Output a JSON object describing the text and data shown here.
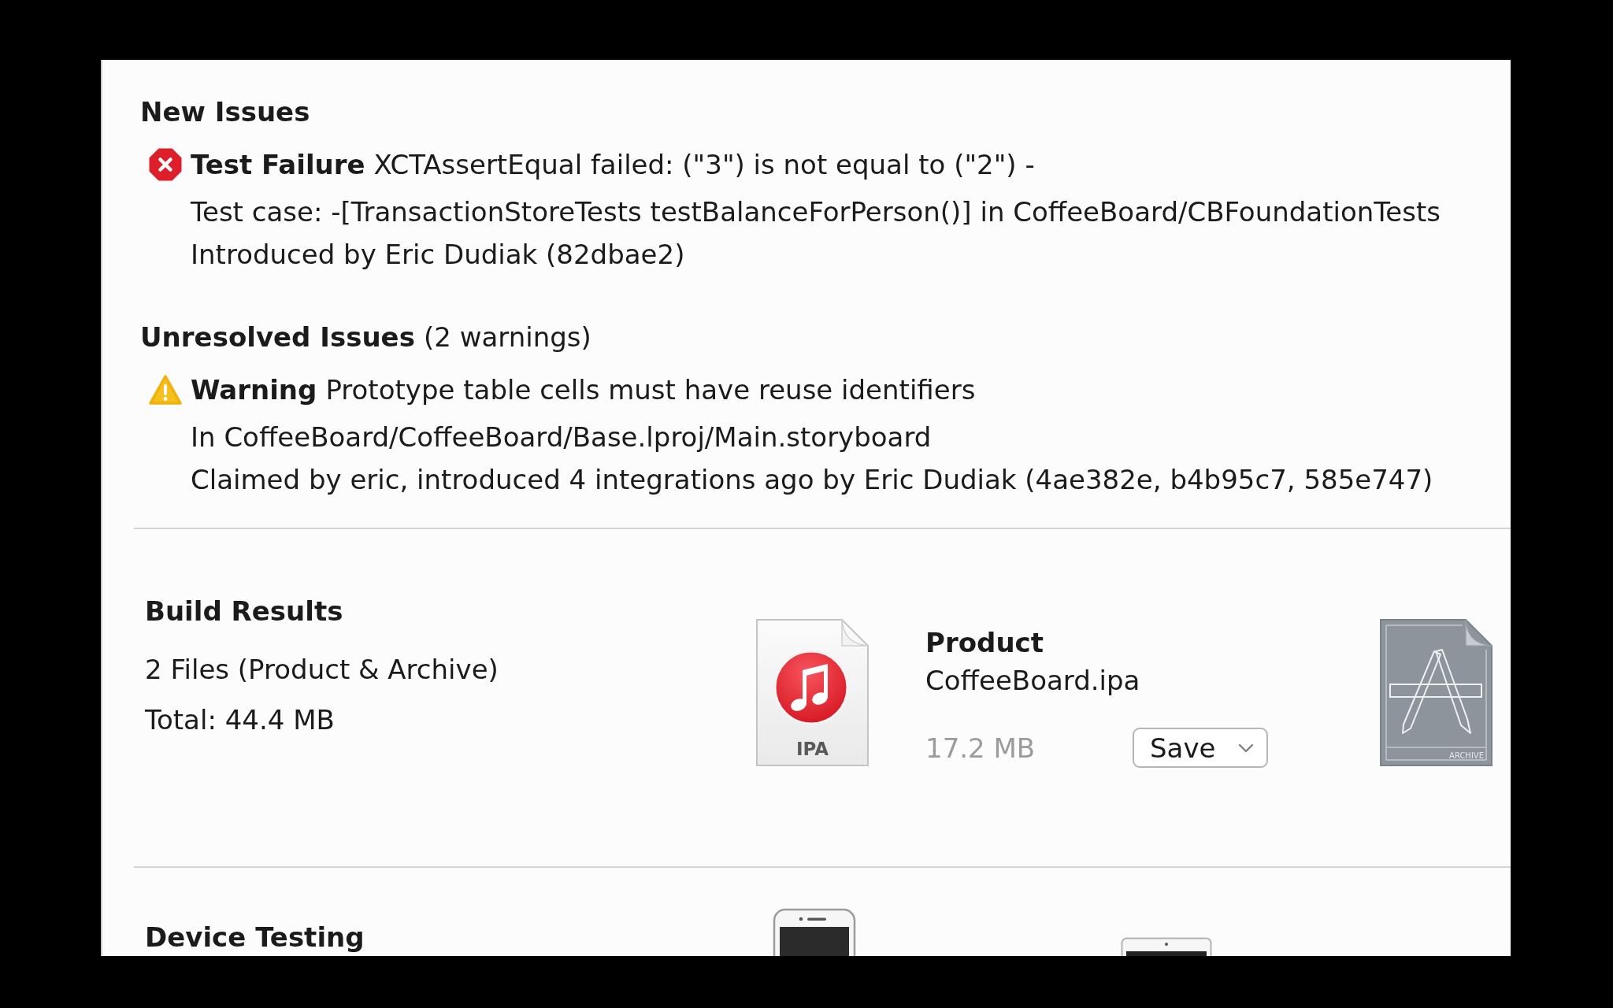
{
  "issue_sections": [
    {
      "title": "New Issues",
      "items": [
        {
          "kind": "error",
          "label": "Test Failure",
          "message": "XCTAssertEqual failed: (\"3\") is not equal to (\"2\") -",
          "details": [
            "Test case: -[TransactionStoreTests testBalanceForPerson()] in CoffeeBoard/CBFoundationTests",
            "Introduced by Eric Dudiak (82dbae2)"
          ]
        }
      ]
    },
    {
      "title": "Unresolved Issues",
      "summary": "(2 warnings)",
      "items": [
        {
          "kind": "warning",
          "label": "Warning",
          "message": "Prototype table cells must have reuse identifiers",
          "details": [
            "In CoffeeBoard/CoffeeBoard/Base.lproj/Main.storyboard",
            "Claimed by eric, introduced 4 integrations ago by Eric Dudiak (4ae382e, b4b95c7, 585e747)"
          ]
        }
      ]
    }
  ],
  "build_results": {
    "title": "Build Results",
    "summary": "2 Files (Product & Archive)",
    "total": "Total: 44.4 MB",
    "files": [
      {
        "kind": "ipa",
        "badge": "IPA",
        "title": "Product",
        "name": "CoffeeBoard.ipa",
        "size": "17.2 MB",
        "action": "Save"
      },
      {
        "kind": "archive",
        "badge": "ARCHIVE"
      }
    ]
  },
  "device_testing": {
    "title": "Device Testing",
    "devices": [
      {
        "kind": "phone"
      },
      {
        "kind": "tablet"
      }
    ]
  }
}
